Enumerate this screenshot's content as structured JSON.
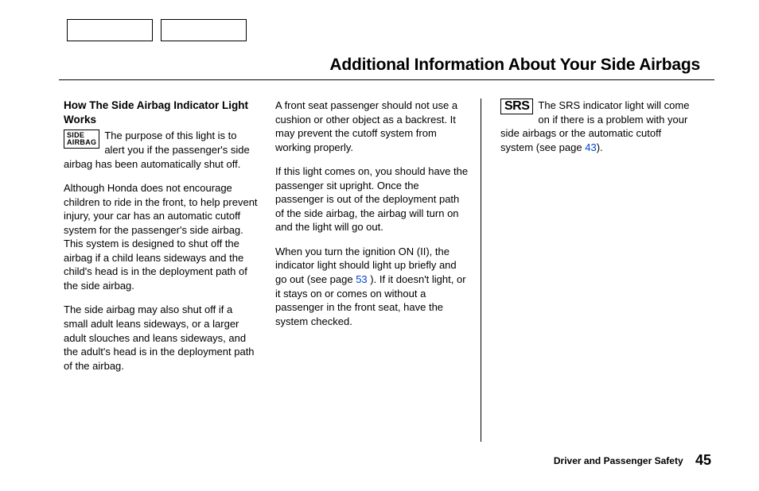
{
  "title": "Additional Information About Your Side Airbags",
  "col1": {
    "subhead": "How The Side Airbag Indicator Light Works",
    "indicator_label_line1": "SIDE",
    "indicator_label_line2": "AIRBAG",
    "lead": "The purpose of this light is to alert you if the passenger's side airbag has been automatically shut off.",
    "p2": "Although Honda does not encourage children to ride in the front, to help prevent injury, your car has an automatic cutoff system for the passenger's side airbag. This system is designed to shut off the airbag if a child leans sideways and the child's head is in the deployment path of the side airbag.",
    "p3": "The side airbag may also shut off if a small adult leans sideways, or a larger adult slouches and leans sideways, and the adult's head is in the deployment path of the airbag."
  },
  "col2": {
    "p1": "A front seat passenger should not use a cushion or other object as a backrest. It may prevent the cutoff system from working properly.",
    "p2": "If this light comes on, you should have the passenger sit upright. Once the passenger is out of the deployment path of the side airbag, the airbag will turn on and the light will go out.",
    "p3a": "When you turn the ignition ON (II), the indicator light should light up briefly and go out (see page ",
    "p3_link": "53",
    "p3b": " ). If it doesn't light, or it stays on or comes on without a passenger in the front seat, have the system checked."
  },
  "col3": {
    "srs_label": "SRS",
    "p1a": "The SRS indicator light will come on if there is a problem with your side airbags or the automatic cutoff system (see page ",
    "p1_link": "43",
    "p1b": ")."
  },
  "footer": {
    "section": "Driver and Passenger Safety",
    "page_number": "45"
  }
}
